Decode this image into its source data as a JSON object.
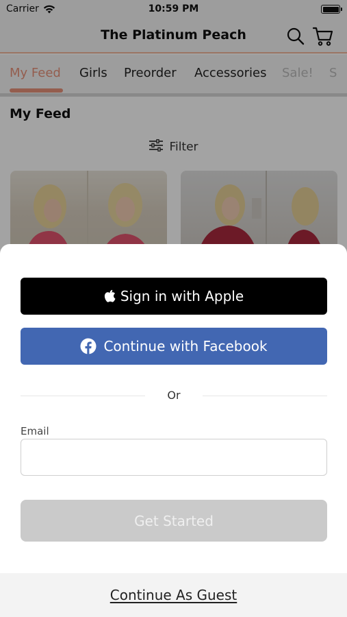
{
  "status_bar": {
    "carrier": "Carrier",
    "time": "10:59 PM",
    "icons": [
      "wifi-icon",
      "battery-icon"
    ]
  },
  "header": {
    "title": "The Platinum Peach",
    "icons": [
      "search-icon",
      "cart-icon"
    ]
  },
  "tabs": [
    {
      "label": "My Feed",
      "active": true
    },
    {
      "label": "Girls",
      "active": false
    },
    {
      "label": "Preorder",
      "active": false
    },
    {
      "label": "Accessories",
      "active": false
    },
    {
      "label": "Sale!",
      "active": false
    },
    {
      "label": "S",
      "active": false
    }
  ],
  "feed": {
    "title": "My Feed",
    "filter_label": "Filter"
  },
  "sheet": {
    "apple_label": "Sign in with Apple",
    "facebook_label": "Continue with Facebook",
    "or_label": "Or",
    "email_label": "Email",
    "email_value": "",
    "email_placeholder": "",
    "get_started_label": "Get Started",
    "guest_label": "Continue As Guest"
  },
  "colors": {
    "accent": "#e8927b",
    "facebook": "#4267b2",
    "apple": "#000000",
    "disabled_button": "#cacaca"
  }
}
